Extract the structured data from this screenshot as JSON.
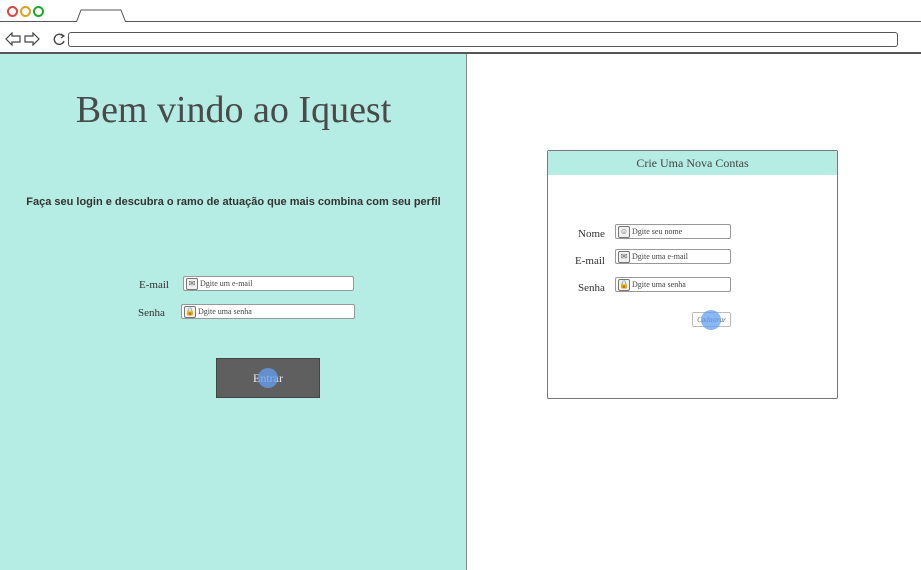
{
  "browser": {
    "icons": {
      "back": "back-arrow-icon",
      "forward": "forward-arrow-icon",
      "reload": "reload-icon"
    },
    "url": ""
  },
  "login": {
    "title": "Bem vindo ao Iquest",
    "tagline": "Faça seu login e descubra o ramo de atuação que mais combina com seu perfil",
    "email_label": "E-mail",
    "email_placeholder": "Dgite um e-mail",
    "password_label": "Senha",
    "password_placeholder": "Dgite uma senha",
    "submit_label": "Entrar",
    "background_color": "#b5ece4"
  },
  "signup": {
    "title": "Crie Uma Nova Contas",
    "name_label": "Nome",
    "name_placeholder": "Dgite seu nome",
    "email_label": "E-mail",
    "email_placeholder": "Dgite uma e-mail",
    "password_label": "Senha",
    "password_placeholder": "Dgite uma senha",
    "submit_label": "Cadastrar"
  }
}
